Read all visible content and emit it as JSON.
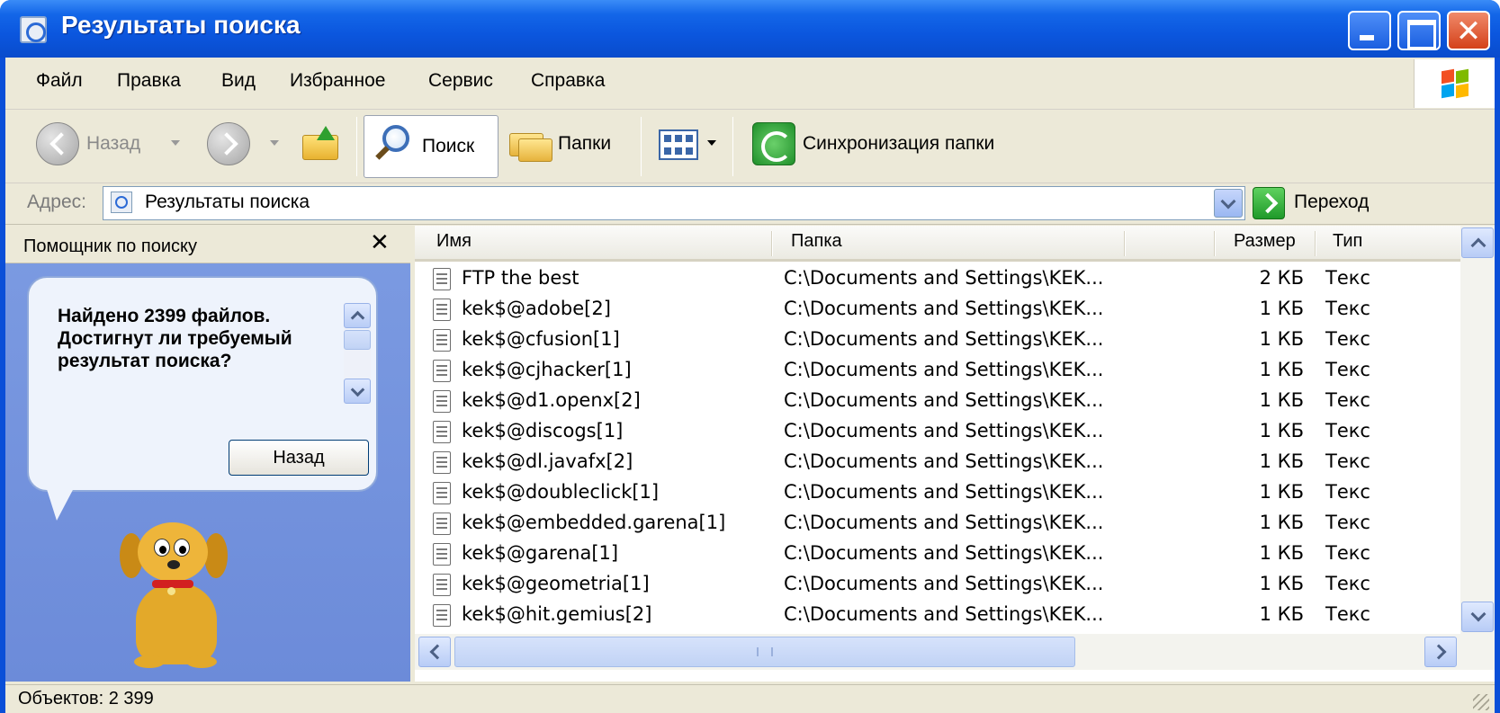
{
  "window": {
    "title": "Результаты поиска"
  },
  "menu": [
    "Файл",
    "Правка",
    "Вид",
    "Избранное",
    "Сервис",
    "Справка"
  ],
  "toolbar": {
    "back_label": "Назад",
    "search_label": "Поиск",
    "folders_label": "Папки",
    "sync_label": "Синхронизация папки"
  },
  "address": {
    "label": "Адрес:",
    "value": "Результаты поиска",
    "go_label": "Переход"
  },
  "assistant": {
    "title": "Помощник по поиску",
    "close_glyph": "✕",
    "message": "Найдено 2399 файлов. Достигнут ли требуемый результат поиска?",
    "back_button": "Назад"
  },
  "columns": {
    "name": "Имя",
    "folder": "Папка",
    "size": "Размер",
    "type": "Тип"
  },
  "files": [
    {
      "name": "FTP the best",
      "folder": "C:\\Documents and Settings\\KEK...",
      "size": "2 КБ",
      "type": "Текс"
    },
    {
      "name": "kek$@adobe[2]",
      "folder": "C:\\Documents and Settings\\KEK...",
      "size": "1 КБ",
      "type": "Текс"
    },
    {
      "name": "kek$@cfusion[1]",
      "folder": "C:\\Documents and Settings\\KEK...",
      "size": "1 КБ",
      "type": "Текс"
    },
    {
      "name": "kek$@cjhacker[1]",
      "folder": "C:\\Documents and Settings\\KEK...",
      "size": "1 КБ",
      "type": "Текс"
    },
    {
      "name": "kek$@d1.openx[2]",
      "folder": "C:\\Documents and Settings\\KEK...",
      "size": "1 КБ",
      "type": "Текс"
    },
    {
      "name": "kek$@discogs[1]",
      "folder": "C:\\Documents and Settings\\KEK...",
      "size": "1 КБ",
      "type": "Текс"
    },
    {
      "name": "kek$@dl.javafx[2]",
      "folder": "C:\\Documents and Settings\\KEK...",
      "size": "1 КБ",
      "type": "Текс"
    },
    {
      "name": "kek$@doubleclick[1]",
      "folder": "C:\\Documents and Settings\\KEK...",
      "size": "1 КБ",
      "type": "Текс"
    },
    {
      "name": "kek$@embedded.garena[1]",
      "folder": "C:\\Documents and Settings\\KEK...",
      "size": "1 КБ",
      "type": "Текс"
    },
    {
      "name": "kek$@garena[1]",
      "folder": "C:\\Documents and Settings\\KEK...",
      "size": "1 КБ",
      "type": "Текс"
    },
    {
      "name": "kek$@geometria[1]",
      "folder": "C:\\Documents and Settings\\KEK...",
      "size": "1 КБ",
      "type": "Текс"
    },
    {
      "name": "kek$@hit.gemius[2]",
      "folder": "C:\\Documents and Settings\\KEK...",
      "size": "1 КБ",
      "type": "Текс"
    }
  ],
  "status": {
    "text": "Объектов: 2 399"
  },
  "colors": {
    "title_blue": "#0b56de",
    "chrome": "#ece9d8",
    "assistant_bg": "#7c9be2"
  }
}
